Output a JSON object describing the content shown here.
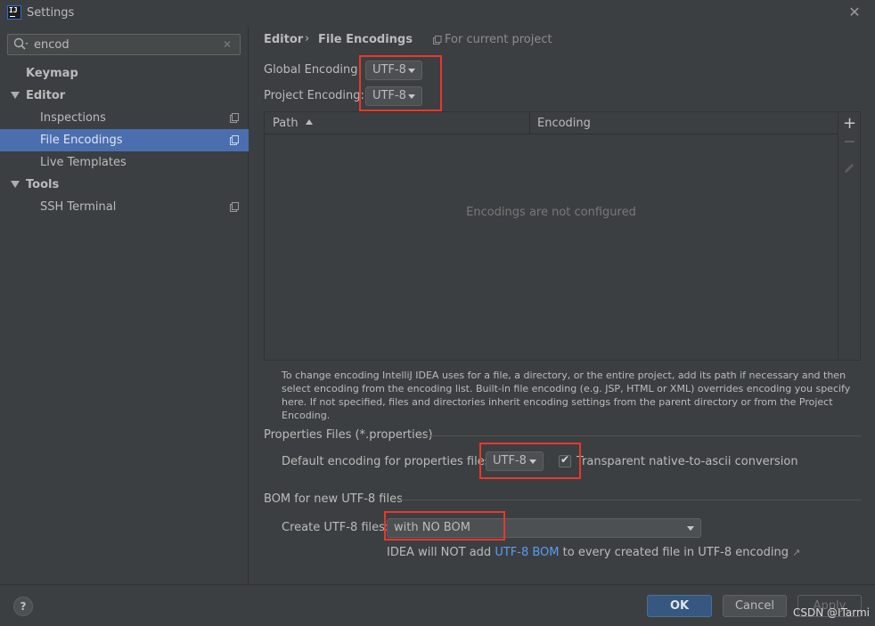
{
  "window": {
    "title": "Settings"
  },
  "search": {
    "value": "encod"
  },
  "sidebar": {
    "items": [
      {
        "label": "Keymap"
      },
      {
        "label": "Editor"
      },
      {
        "label": "Inspections"
      },
      {
        "label": "File Encodings"
      },
      {
        "label": "Live Templates"
      },
      {
        "label": "Tools"
      },
      {
        "label": "SSH Terminal"
      }
    ]
  },
  "breadcrumb": {
    "parent": "Editor",
    "separator": "›",
    "page": "File Encodings",
    "scope": "For current project"
  },
  "encoding": {
    "global_label": "Global Encoding:",
    "global_value": "UTF-8",
    "project_label": "Project Encoding:",
    "project_value": "UTF-8"
  },
  "table": {
    "col_path": "Path",
    "col_encoding": "Encoding",
    "empty": "Encodings are not configured",
    "add": "+"
  },
  "help_text": "To change encoding IntelliJ IDEA uses for a file, a directory, or the entire project, add its path if necessary and then select encoding from the encoding list. Built-in file encoding (e.g. JSP, HTML or XML) overrides encoding you specify here. If not specified, files and directories inherit encoding settings from the parent directory or from the Project Encoding.",
  "properties": {
    "section": "Properties Files (*.properties)",
    "label": "Default encoding for properties files:",
    "value": "UTF-8",
    "checkbox_label": "Transparent native-to-ascii conversion",
    "checked": true
  },
  "bom": {
    "section": "BOM for new UTF-8 files",
    "label": "Create UTF-8 files:",
    "value": "with NO BOM",
    "note_prefix": "IDEA will NOT add ",
    "note_link": "UTF-8 BOM",
    "note_suffix": " to every created file in UTF-8 encoding",
    "note_arrow": "↗"
  },
  "footer": {
    "help": "?",
    "ok": "OK",
    "cancel": "Cancel",
    "apply": "Apply",
    "watermark": "CSDN @ITarmi"
  },
  "colors": {
    "accent": "#4b6eaf",
    "highlight": "#e9382c",
    "link": "#589df6",
    "ok_button": "#365880"
  }
}
